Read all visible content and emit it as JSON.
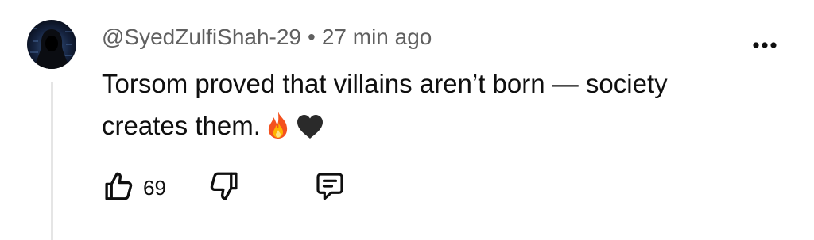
{
  "comment": {
    "handle": "@SyedZulfiShah-29",
    "separator": "•",
    "timestamp": "27 min ago",
    "text_line1": "Torsom proved that villains aren’t born — society",
    "text_line2": "creates them.",
    "emojis": [
      "fire-emoji",
      "black-heart-emoji"
    ],
    "likes": "69"
  },
  "icons": {
    "more": "more-vert-icon",
    "like": "thumbs-up-icon",
    "dislike": "thumbs-down-icon",
    "reply": "reply-comment-icon"
  },
  "colors": {
    "text": "#0f0f0f",
    "meta": "#606060",
    "thread_line": "#e5e5e5"
  }
}
